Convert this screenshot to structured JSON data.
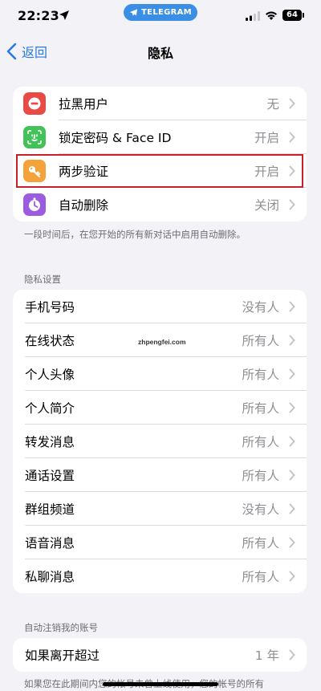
{
  "status_bar": {
    "time": "22:23",
    "telegram_pill": "TELEGRAM",
    "battery": "64",
    "accent": "#3a8ee6"
  },
  "nav": {
    "back_label": "返回",
    "title": "隐私"
  },
  "security_group": {
    "items": [
      {
        "label": "拉黑用户",
        "value": "无",
        "icon": "block-icon",
        "color": "#e84a45"
      },
      {
        "label": "锁定密码 & Face ID",
        "value": "开启",
        "icon": "face-id-icon",
        "color": "#43c25a"
      },
      {
        "label": "两步验证",
        "value": "开启",
        "icon": "key-icon",
        "color": "#f3a33a"
      },
      {
        "label": "自动删除",
        "value": "关闭",
        "icon": "timer-icon",
        "color": "#9b5ce0"
      }
    ],
    "footer": "一段时间后，在您开始的所有新对话中启用自动删除。"
  },
  "privacy_settings": {
    "header": "隐私设置",
    "items": [
      {
        "label": "手机号码",
        "value": "没有人"
      },
      {
        "label": "在线状态",
        "value": "所有人"
      },
      {
        "label": "个人头像",
        "value": "所有人"
      },
      {
        "label": "个人简介",
        "value": "所有人"
      },
      {
        "label": "转发消息",
        "value": "所有人"
      },
      {
        "label": "通话设置",
        "value": "所有人"
      },
      {
        "label": "群组频道",
        "value": "没有人"
      },
      {
        "label": "语音消息",
        "value": "所有人"
      },
      {
        "label": "私聊消息",
        "value": "所有人"
      }
    ]
  },
  "auto_delete_account": {
    "header": "自动注销我的账号",
    "items": [
      {
        "label": "如果离开超过",
        "value": "1 年"
      }
    ],
    "footer": "如果您在此期间内您的帐号未曾上线使用，您的帐号的所有"
  },
  "watermark": "zhpengfei.com",
  "highlight_color": "#c8202a"
}
